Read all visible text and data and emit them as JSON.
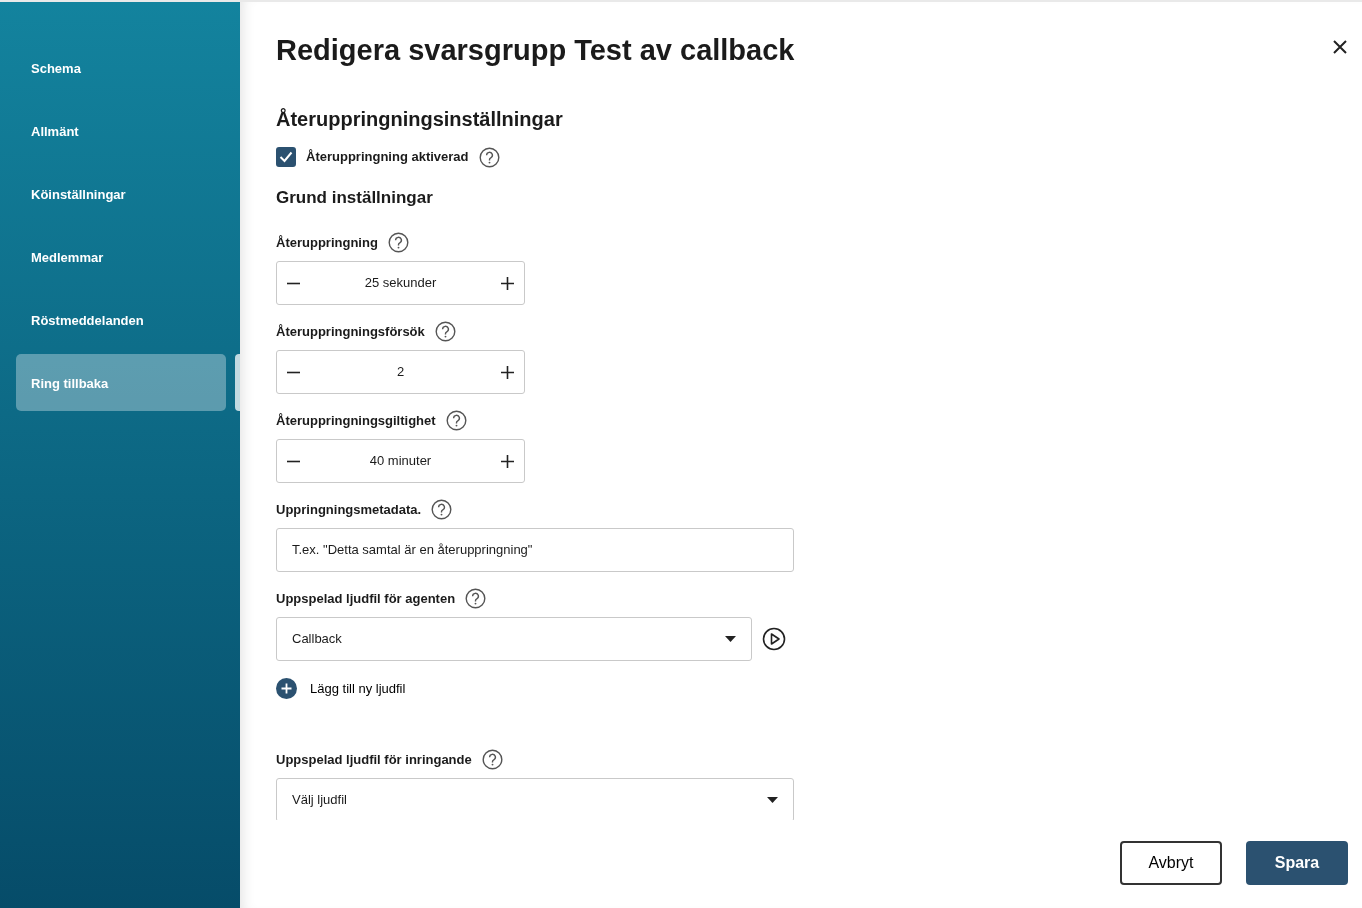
{
  "sidebar": {
    "items": [
      {
        "label": "Schema",
        "selected": false
      },
      {
        "label": "Allmänt",
        "selected": false
      },
      {
        "label": "Köinställningar",
        "selected": false
      },
      {
        "label": "Medlemmar",
        "selected": false
      },
      {
        "label": "Röstmeddelanden",
        "selected": false
      },
      {
        "label": "Ring tillbaka",
        "selected": true
      }
    ]
  },
  "dialog": {
    "title": "Redigera svarsgrupp Test av callback",
    "section_title": "Återuppringningsinställningar",
    "callback_enabled": {
      "label": "Återuppringning aktiverad",
      "checked": true
    },
    "subsection_title": "Grund inställningar",
    "steppers": [
      {
        "label": "Återuppringning",
        "value": "25 sekunder"
      },
      {
        "label": "Återuppringningsförsök",
        "value": "2"
      },
      {
        "label": "Återuppringningsgiltighet",
        "value": "40 minuter"
      }
    ],
    "metadata": {
      "label": "Uppringningsmetadata.",
      "placeholder": "T.ex. \"Detta samtal är en återuppringning\""
    },
    "agent_audio": {
      "label": "Uppspelad ljudfil för agenten",
      "value": "Callback"
    },
    "add_audio": {
      "label": "Lägg till ny ljudfil"
    },
    "caller_audio": {
      "label": "Uppspelad ljudfil för inringande",
      "placeholder": "Välj ljudfil"
    },
    "buttons": {
      "cancel": "Avbryt",
      "save": "Spara"
    }
  }
}
